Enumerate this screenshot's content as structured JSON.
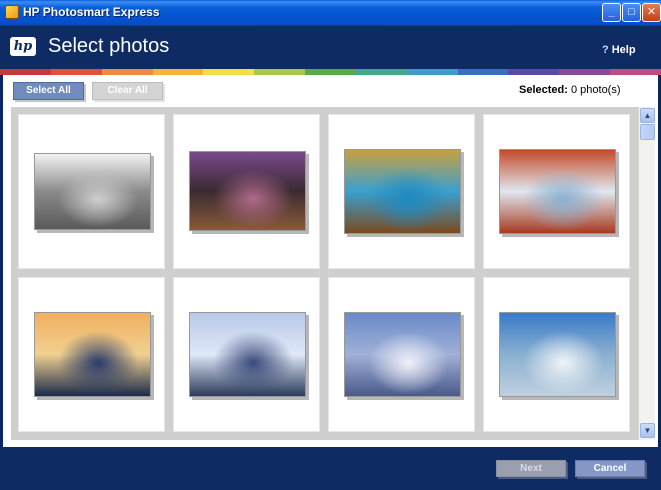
{
  "window": {
    "title": "HP Photosmart Express",
    "minimize_icon": "minimize-icon",
    "maximize_icon": "maximize-icon",
    "close_icon": "close-icon",
    "minimize_glyph": "_",
    "maximize_glyph": "□",
    "close_glyph": "✕"
  },
  "header": {
    "logo": "hp",
    "title": "Select photos",
    "help_label": "Help",
    "help_glyph": "?"
  },
  "rainbow_colors": [
    "#c7383e",
    "#e0503e",
    "#f08a3c",
    "#f1b53c",
    "#f4dd4a",
    "#a8c84a",
    "#5aa84a",
    "#3fa98a",
    "#3a9fc8",
    "#3a6fc0",
    "#5a4aa8",
    "#8a4a98",
    "#c04a88"
  ],
  "toolbar": {
    "select_all_label": "Select All",
    "clear_all_label": "Clear All",
    "selected_label": "Selected:",
    "selected_value": "0 photo(s)"
  },
  "photos": [
    {
      "name": "photo-kite-flight",
      "colors": [
        "#f2f2f2",
        "#cfcfcf",
        "#8a8a8a",
        "#5a5a5a"
      ]
    },
    {
      "name": "photo-dancers-sunset",
      "colors": [
        "#7a4a8a",
        "#b06a8a",
        "#3a2a30",
        "#8a5a3a"
      ]
    },
    {
      "name": "photo-hot-spring",
      "colors": [
        "#c8a040",
        "#1e8ac0",
        "#3aa0d0",
        "#7a4a20"
      ]
    },
    {
      "name": "photo-river-delta",
      "colors": [
        "#c44a2a",
        "#8ab0d0",
        "#e0e8f0",
        "#a83a20"
      ]
    },
    {
      "name": "photo-sea-stacks",
      "colors": [
        "#f0b060",
        "#2a3a6a",
        "#f0d090",
        "#1a2a4a"
      ]
    },
    {
      "name": "photo-crater-lake",
      "colors": [
        "#b8c8e8",
        "#3a4a7a",
        "#e0e8f8",
        "#2a3a5a"
      ]
    },
    {
      "name": "photo-mountain-peak",
      "colors": [
        "#6a8ac8",
        "#f0f0f8",
        "#a0b0d8",
        "#4a5a8a"
      ]
    },
    {
      "name": "photo-wave-surfer",
      "colors": [
        "#3a7ac8",
        "#f0f4f8",
        "#8ab0d0",
        "#c0d0e0"
      ]
    }
  ],
  "scrollbar": {
    "up_icon": "scroll-up-icon",
    "down_icon": "scroll-down-icon",
    "up_glyph": "▲",
    "down_glyph": "▼"
  },
  "footer": {
    "next_label": "Next",
    "cancel_label": "Cancel"
  }
}
